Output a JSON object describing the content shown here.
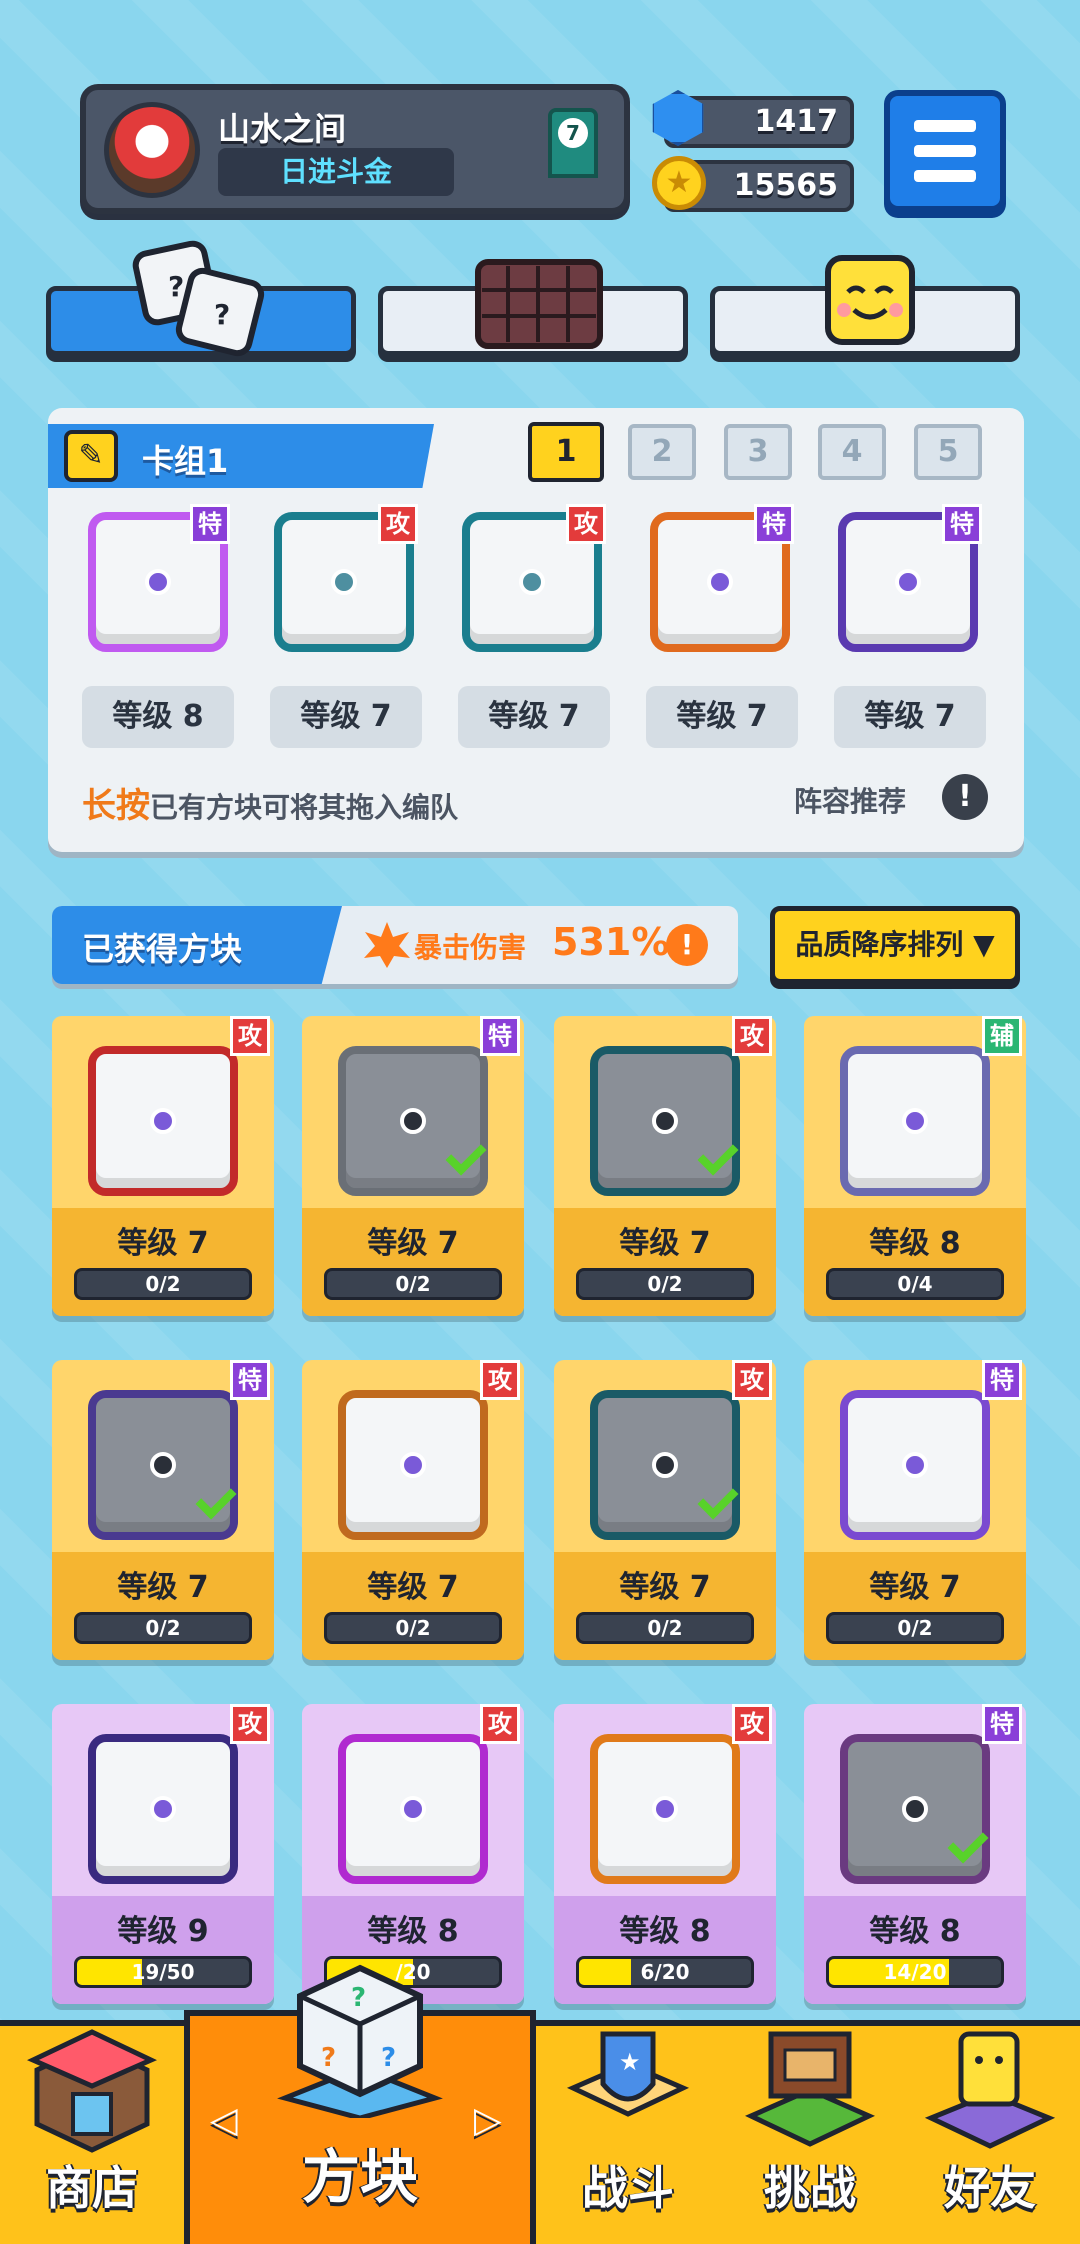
{
  "profile": {
    "name": "山水之间",
    "title": "日进斗金",
    "rank": "7"
  },
  "currency": {
    "gems": "1417",
    "coins": "15565"
  },
  "deck": {
    "title": "卡组1",
    "tabs": [
      "1",
      "2",
      "3",
      "4",
      "5"
    ],
    "slots": [
      {
        "tag": "特",
        "level": "等级 8"
      },
      {
        "tag": "攻",
        "level": "等级 7"
      },
      {
        "tag": "攻",
        "level": "等级 7"
      },
      {
        "tag": "特",
        "level": "等级 7"
      },
      {
        "tag": "特",
        "level": "等级 7"
      }
    ],
    "hint_highlight": "长按",
    "hint_text": "已有方块可将其拖入编队",
    "lineup_label": "阵容推荐",
    "lineup_icon": "!"
  },
  "owned": {
    "title": "已获得方块",
    "crit_label": "暴击伤害",
    "crit_value": "531%",
    "crit_icon": "!",
    "sort_label": "品质降序排列 ▼"
  },
  "cards": [
    {
      "tag": "攻",
      "level": "等级 7",
      "progress": "0/2",
      "fill": 0,
      "checked": false
    },
    {
      "tag": "特",
      "level": "等级 7",
      "progress": "0/2",
      "fill": 0,
      "checked": true
    },
    {
      "tag": "攻",
      "level": "等级 7",
      "progress": "0/2",
      "fill": 0,
      "checked": true
    },
    {
      "tag": "辅",
      "level": "等级 8",
      "progress": "0/4",
      "fill": 0,
      "checked": false
    },
    {
      "tag": "特",
      "level": "等级 7",
      "progress": "0/2",
      "fill": 0,
      "checked": true
    },
    {
      "tag": "攻",
      "level": "等级 7",
      "progress": "0/2",
      "fill": 0,
      "checked": false
    },
    {
      "tag": "攻",
      "level": "等级 7",
      "progress": "0/2",
      "fill": 0,
      "checked": true
    },
    {
      "tag": "特",
      "level": "等级 7",
      "progress": "0/2",
      "fill": 0,
      "checked": false
    },
    {
      "tag": "攻",
      "level": "等级 9",
      "progress": "19/50",
      "fill": 0.38,
      "checked": false
    },
    {
      "tag": "攻",
      "level": "等级 8",
      "progress": "/20",
      "fill": 0.5,
      "checked": false
    },
    {
      "tag": "攻",
      "level": "等级 8",
      "progress": "6/20",
      "fill": 0.3,
      "checked": false
    },
    {
      "tag": "特",
      "level": "等级 8",
      "progress": "14/20",
      "fill": 0.7,
      "checked": true
    }
  ],
  "nav": {
    "shop": "商店",
    "blocks": "方块",
    "battle": "战斗",
    "challenge": "挑战",
    "friends": "好友",
    "prev_arrow": "◁",
    "next_arrow": "▷"
  },
  "colors": {
    "accent_blue": "#2d8de8",
    "gold": "#ffd21e",
    "attack_tag": "#e33b3b",
    "special_tag": "#8a3fd8",
    "support_tag": "#2bb673"
  }
}
